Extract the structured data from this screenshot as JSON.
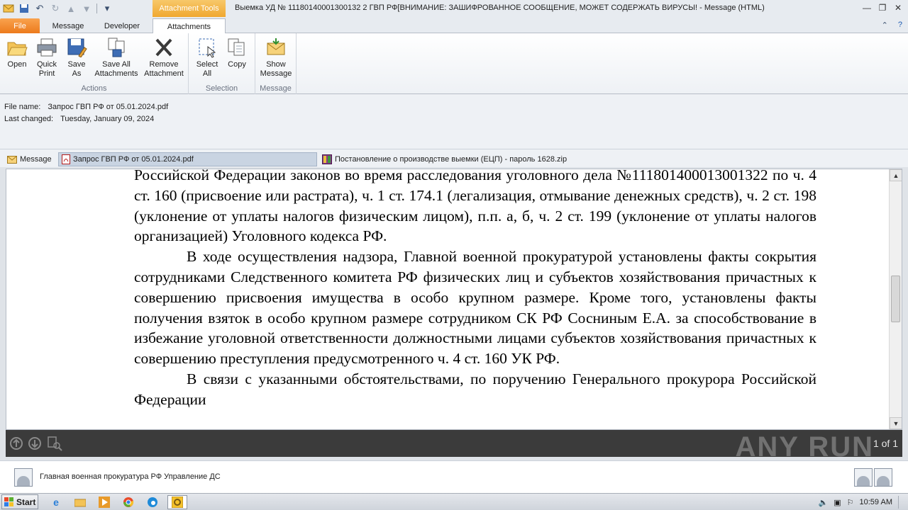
{
  "window": {
    "contextual_tab": "Attachment Tools",
    "title": "Выемка УД № 11180140001300132 2  ГВП РФ[ВНИМАНИЕ: ЗАШИФРОВАННОЕ СООБЩЕНИЕ, МОЖЕТ СОДЕРЖАТЬ ВИРУСЫ! -  Message (HTML)"
  },
  "tabs": [
    "File",
    "Message",
    "Developer",
    "Attachments"
  ],
  "ribbon": {
    "actions": {
      "label": "Actions",
      "open": "Open",
      "quick_print": "Quick\nPrint",
      "save_as": "Save\nAs",
      "save_all": "Save All\nAttachments",
      "remove": "Remove\nAttachment"
    },
    "selection": {
      "label": "Selection",
      "select_all": "Select\nAll",
      "copy": "Copy"
    },
    "message": {
      "label": "Message",
      "show_message": "Show\nMessage"
    }
  },
  "info": {
    "file_name_label": "File name:",
    "file_name": "Запрос ГВП РФ от 05.01.2024.pdf",
    "last_changed_label": "Last changed:",
    "last_changed": "Tuesday, January 09, 2024"
  },
  "attachments": [
    {
      "label": "Message",
      "icon": "envelope-icon"
    },
    {
      "label": "Запрос ГВП РФ от 05.01.2024.pdf",
      "icon": "pdf-icon"
    },
    {
      "label": "Постановление о производстве выемки (ЕЦП) - пароль 1628.zip",
      "icon": "zip-icon"
    }
  ],
  "document": {
    "p1": "Российской Федерации законов во время расследования уголовного дела №111801400013001322 по ч. 4 ст. 160 (присвоение или растрата), ч. 1 ст. 174.1 (легализация, отмывание денежных средств), ч. 2 ст. 198 (уклонение от уплаты налогов физическим лицом), п.п. а, б, ч. 2 ст. 199 (уклонение от уплаты налогов организацией) Уголовного кодекса РФ.",
    "p2": "В ходе осуществления надзора, Главной военной прокуратурой установлены факты сокрытия сотрудниками Следственного комитета РФ физических лиц и субъектов хозяйствования причастных к совершению присвоения имущества в особо крупном размере. Кроме того, установлены факты получения взяток в особо крупном размере сотрудником СК РФ Сосниным Е.А. за способствование в избежание уголовной ответственности должностными лицами субъектов хозяйствования причастных к совершению преступления предусмотренного ч. 4 ст. 160 УК РФ.",
    "p3": "В связи с указанными обстоятельствами, по поручению Генерального прокурора Российской Федерации"
  },
  "pager": {
    "text": "1 of 1"
  },
  "watermark": "ANY RUN",
  "people": {
    "sender": "Главная военная прокуратура РФ Управление ДС"
  },
  "taskbar": {
    "start": "Start",
    "time": "10:59 AM"
  }
}
